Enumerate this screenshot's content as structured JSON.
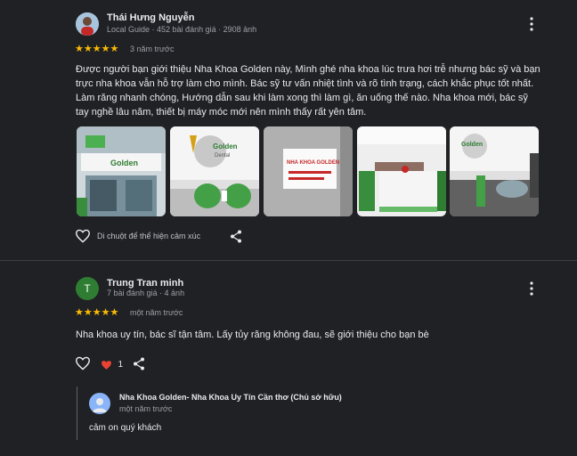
{
  "review1": {
    "name": "Thái Hưng Nguyễn",
    "meta": "Local Guide · 452 bài đánh giá · 2908 ảnh",
    "stars": "★★★★★",
    "time": "3 năm trước",
    "text": "Được người bạn giới thiệu Nha Khoa Golden này, Mình ghé nha khoa lúc trưa hơi trễ nhưng bác sỹ và bạn trực nha khoa vẫn hỗ trợ làm cho mình. Bác sỹ tư vấn nhiệt tình và rõ tình trạng, cách khắc phục tốt nhất. Làm răng nhanh chóng, Hướng dẫn sau khi làm xong thì làm gì, ăn uống thế nào. Nha khoa mới, bác sỹ tay nghề lâu năm, thiết bị máy móc mới nên mình thấy rất yên tâm.",
    "like_hint": "Di chuột để thể hiện cảm xúc",
    "photo_signs": [
      "Golden",
      "Golden\nDental",
      "NHA KHOA GOLDEN",
      "",
      "Golden\nDental"
    ]
  },
  "review2": {
    "initial": "T",
    "name": "Trung Tran minh",
    "meta": "7 bài đánh giá · 4 ảnh",
    "stars": "★★★★★",
    "time": "một năm trước",
    "text": "Nha khoa uy tín, bác sĩ tận tâm. Lấy tủy răng không đau, sẽ giới thiệu cho bạn bè",
    "like_count": "1"
  },
  "owner_reply": {
    "name": "Nha Khoa Golden- Nha Khoa Uy Tín Cần thơ (Chủ sở hữu)",
    "time": "một năm trước",
    "text": "cảm on quý khách"
  },
  "colors": {
    "background": "#202124",
    "star": "#fbbc04",
    "heart": "#ea4335",
    "avatar_green": "#2e7d32",
    "owner_avatar": "#8ab4f8"
  }
}
